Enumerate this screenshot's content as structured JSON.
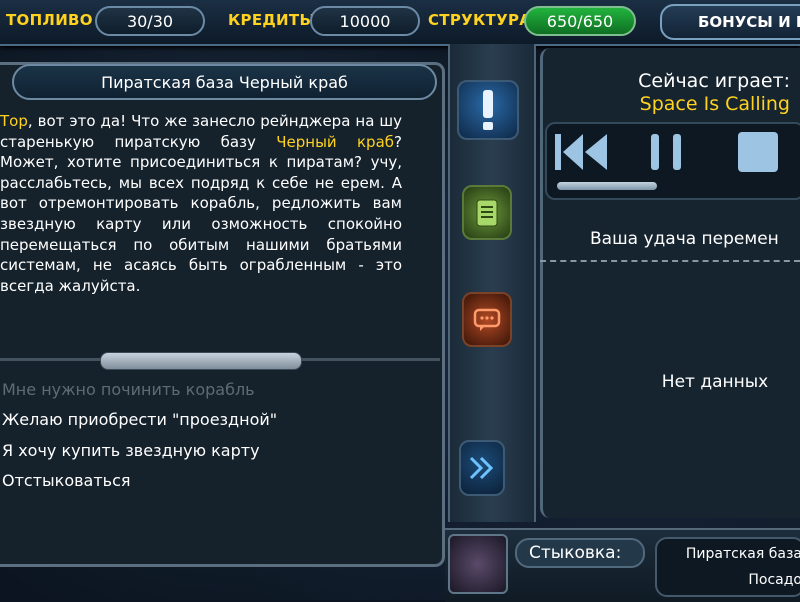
{
  "topbar": {
    "fuel_label": "ТОПЛИВО",
    "fuel_value": "30/30",
    "credits_label": "КРЕДИТЫ",
    "credits_value": "10000",
    "structure_label": "СТРУКТУРА",
    "structure_value": "650/650",
    "bonus_label": "БОНУСЫ И П"
  },
  "dialog": {
    "title": "Пиратская база Черный краб",
    "text_parts": [
      {
        "text": " ",
        "highlight": false
      },
      {
        "text": "Тор",
        "highlight": true
      },
      {
        "text": ", вот это да! Что же занесло рейнджера на шу старенькую пиратскую базу ",
        "highlight": false
      },
      {
        "text": "Черный краб",
        "highlight": true
      },
      {
        "text": "? Может, хотите присоединиться к пиратам? учу, расслабьтесь, мы всех подряд к себе не ерем. А вот отремонтировать корабль, редложить вам звездную карту или озможность спокойно перемещаться по обитым нашими братьями системам, не асаясь быть ограбленным - это всегда жалуйста.",
        "highlight": false
      }
    ],
    "options": [
      {
        "label": "Мне нужно починить корабль",
        "disabled": true
      },
      {
        "label": "Желаю приобрести \"проездной\"",
        "disabled": false
      },
      {
        "label": "Я хочу купить звездную карту",
        "disabled": false
      },
      {
        "label": "Отстыковаться",
        "disabled": false
      }
    ]
  },
  "sidebar_icons": [
    "alert-icon",
    "notes-icon",
    "chat-icon",
    "forward-icon"
  ],
  "music": {
    "now_playing_label": "Сейчас играет:",
    "track": "Space Is Calling",
    "progress": 0.4
  },
  "info": {
    "luck_text": "Ваша удача перемен",
    "empty_text": "Нет данных"
  },
  "docking": {
    "label": "Стыковка:",
    "station": "Пиратская база",
    "sub": "Посадо"
  },
  "colors": {
    "accent": "#ffd21f",
    "pill_green": "#1d9e36",
    "frame": "#5b6f80"
  }
}
